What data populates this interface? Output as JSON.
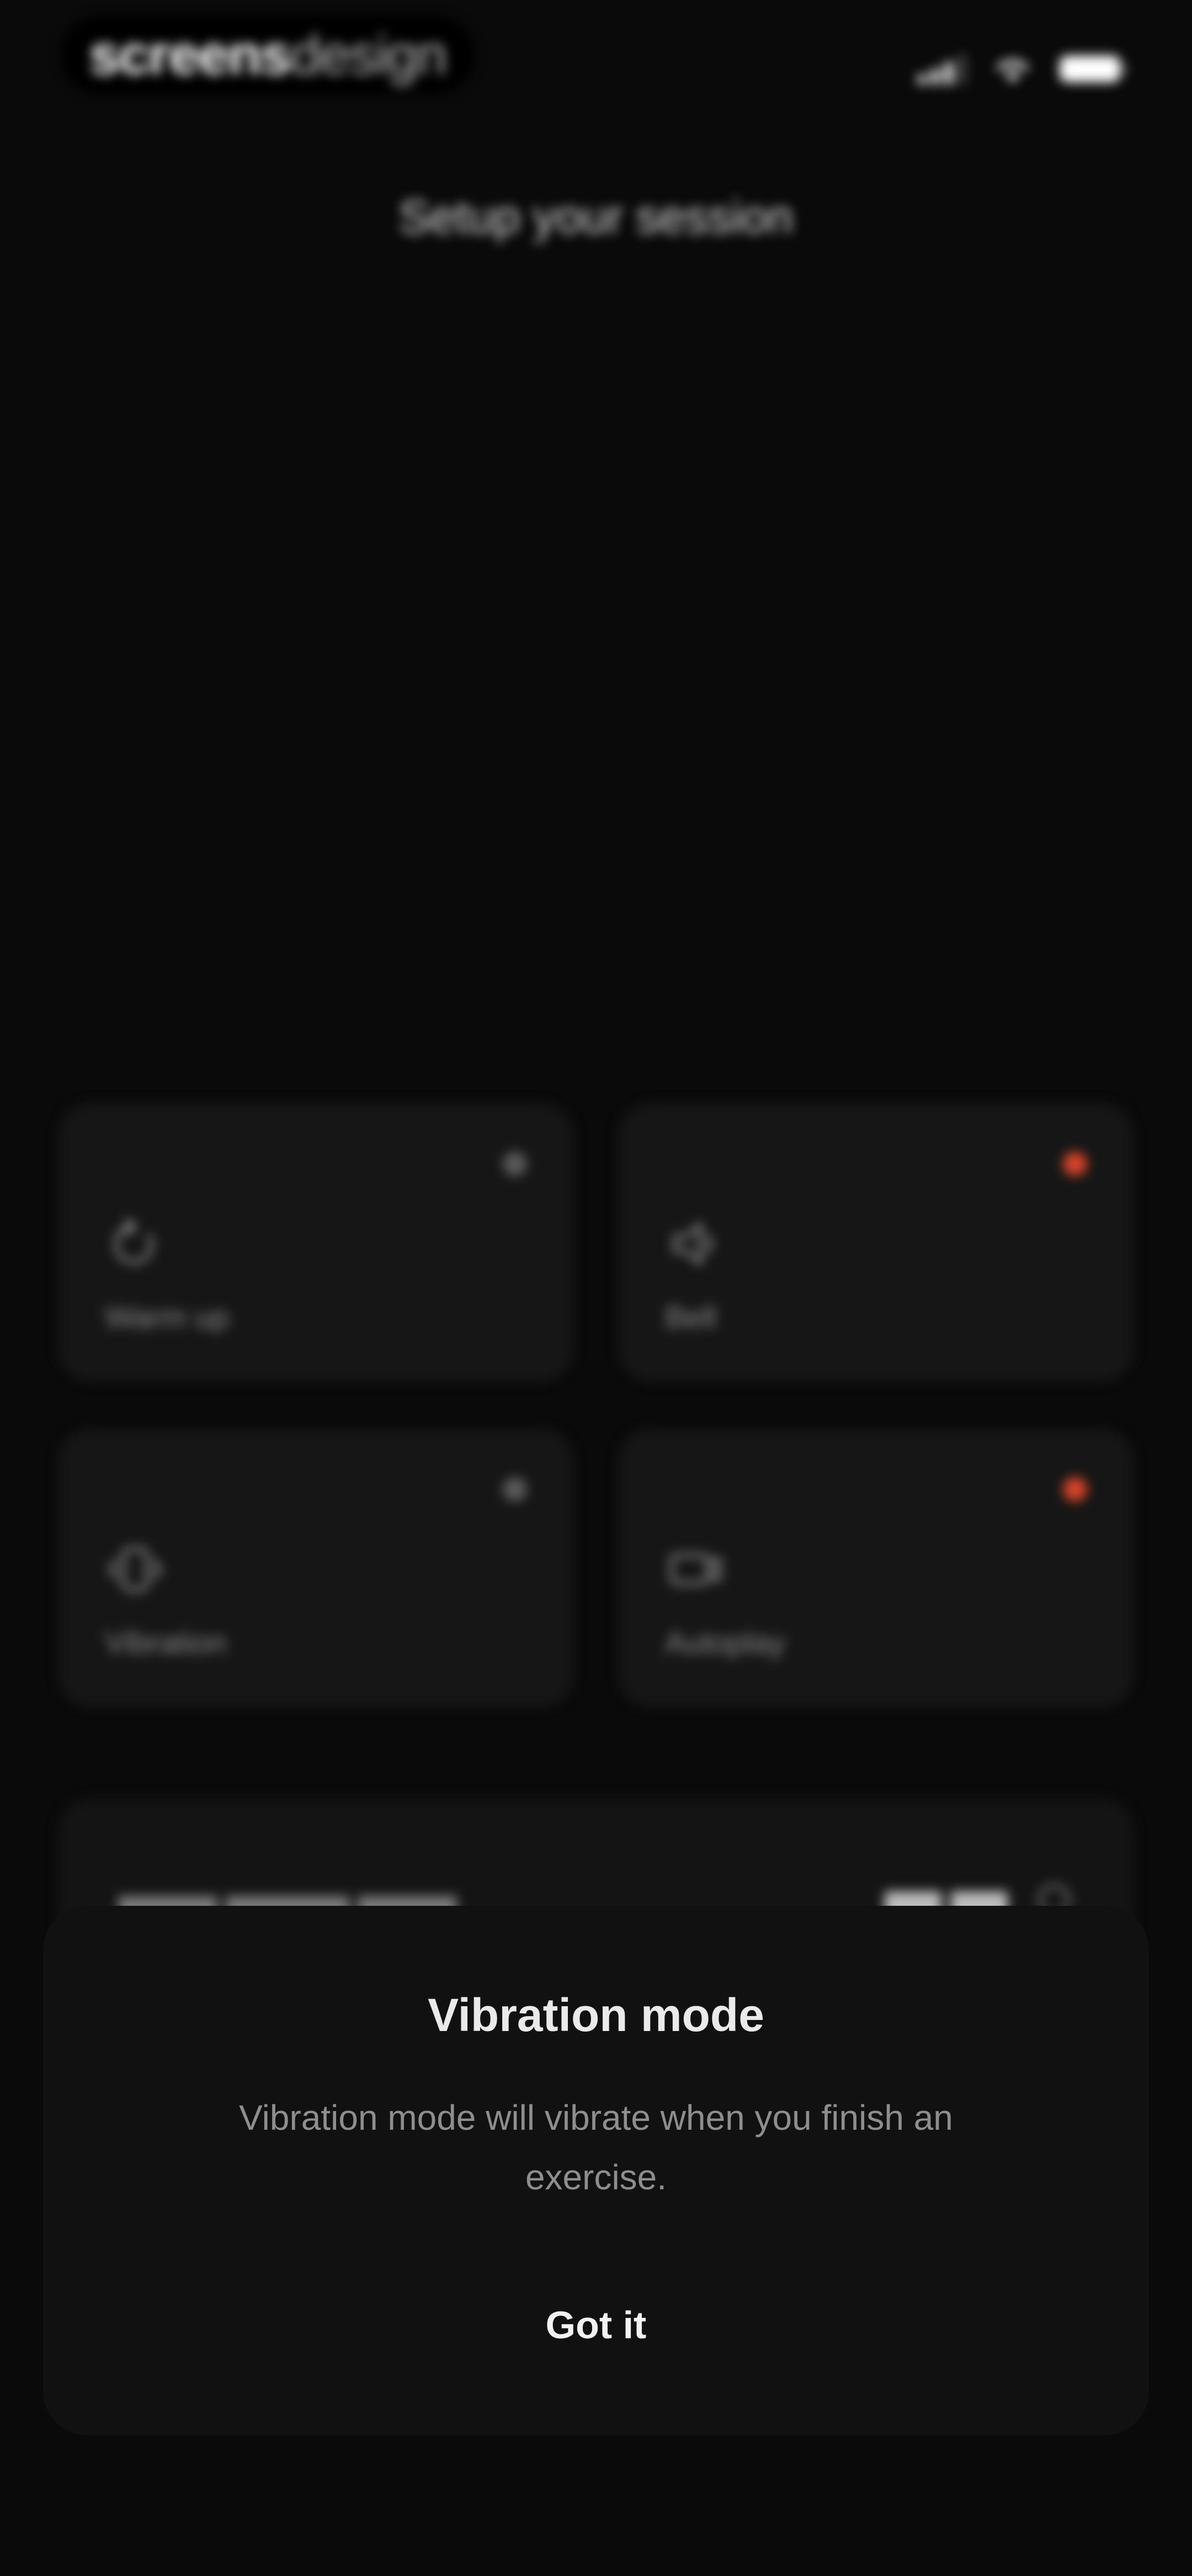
{
  "watermark": {
    "part1": "screens",
    "part2": "design"
  },
  "header": {
    "title": "Setup your session"
  },
  "cards": [
    {
      "label": "Warm up",
      "icon": "refresh-icon",
      "active": false
    },
    {
      "label": "Bell",
      "icon": "speaker-icon",
      "active": true
    },
    {
      "label": "Vibration",
      "icon": "vibration-icon",
      "active": false
    },
    {
      "label": "Autoplay",
      "icon": "video-icon",
      "active": true
    }
  ],
  "sheet": {
    "title": "Vibration mode",
    "body": "Vibration mode will vibrate when you finish an exercise.",
    "button_label": "Got it"
  },
  "colors": {
    "background": "#0a0a0a",
    "card": "#161616",
    "active_dot": "#d8452a",
    "inactive_dot": "#5a5a5a"
  }
}
